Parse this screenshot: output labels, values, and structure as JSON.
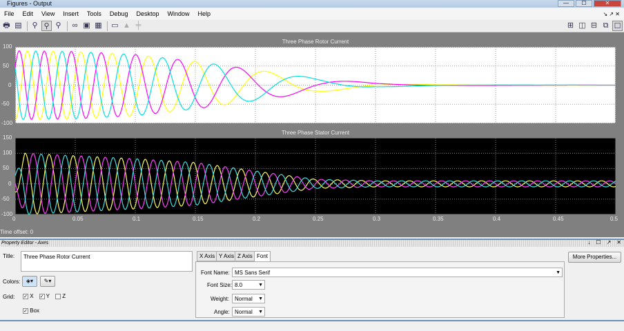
{
  "window": {
    "title": "Figures - Output",
    "buttons": [
      "—",
      "☐",
      "✕"
    ]
  },
  "menu": [
    "File",
    "Edit",
    "View",
    "Insert",
    "Tools",
    "Debug",
    "Desktop",
    "Window",
    "Help"
  ],
  "toolbar": {
    "icons": [
      "print-icon",
      "paste-icon",
      "zoom-in-icon",
      "zoom-out-active-icon",
      "zoom-icon",
      "binoculars-icon",
      "data-cursor-icon",
      "brush-icon",
      "dock-icon",
      "lock-icon",
      "link-icon"
    ],
    "layout_icons": [
      "tile-grid-icon",
      "split-vertical-icon",
      "split-horizontal-icon",
      "float-icon",
      "maximize-icon"
    ]
  },
  "chart_data": [
    {
      "type": "line",
      "title": "Three Phase Rotor Current",
      "background": "#ffffff",
      "grid": true,
      "xlim": [
        0,
        0.5
      ],
      "ylim": [
        -100,
        100
      ],
      "xticks": [
        0,
        0.05,
        0.1,
        0.15,
        0.2,
        0.25,
        0.3,
        0.35,
        0.4,
        0.45,
        0.5
      ],
      "yticks": [
        100,
        50,
        0,
        -50,
        -100
      ],
      "model": "i(t) = A(t)·sin(2π∫f dt + phase)",
      "envelope": {
        "t": [
          0,
          0.05,
          0.1,
          0.15,
          0.2,
          0.25,
          0.3,
          0.35,
          0.5
        ],
        "amplitude": [
          90,
          88,
          80,
          62,
          40,
          18,
          5,
          1,
          0
        ]
      },
      "frequency": {
        "t": [
          0,
          0.05,
          0.1,
          0.15,
          0.2,
          0.25,
          0.3,
          0.5
        ],
        "hz": [
          50,
          42,
          32,
          22,
          13,
          8,
          5,
          4
        ]
      },
      "series": [
        {
          "color": "#ffff00",
          "phase_deg": -90
        },
        {
          "color": "#ff00ff",
          "phase_deg": 30
        },
        {
          "color": "#00e0e0",
          "phase_deg": 150
        }
      ]
    },
    {
      "type": "line",
      "title": "Three Phase Stator Current",
      "background": "#000000",
      "grid": true,
      "xlim": [
        0,
        0.5
      ],
      "ylim": [
        -100,
        150
      ],
      "xticks": [
        0,
        0.05,
        0.1,
        0.15,
        0.2,
        0.25,
        0.3,
        0.35,
        0.4,
        0.45,
        0.5
      ],
      "yticks": [
        150,
        100,
        50,
        0,
        -50,
        -100
      ],
      "model": "i(t) = A(t)·sin(2π·50·t + phase)",
      "envelope": {
        "t": [
          0,
          0.008,
          0.05,
          0.1,
          0.15,
          0.2,
          0.25,
          0.3,
          0.5
        ],
        "amplitude": [
          30,
          100,
          92,
          82,
          70,
          42,
          15,
          10,
          10
        ]
      },
      "frequency_hz": 50,
      "series": [
        {
          "color": "#ffff60",
          "phase_deg": -60
        },
        {
          "color": "#ff40ff",
          "phase_deg": 180
        },
        {
          "color": "#40e0e0",
          "phase_deg": 60
        }
      ]
    }
  ],
  "time_offset": {
    "label": "Time offset:",
    "value": "0"
  },
  "property_editor": {
    "header": "Property Editor - Axes",
    "header_buttons": [
      "↓",
      "☐",
      "↗",
      "✕"
    ],
    "title_label": "Title:",
    "title_value": "Three Phase Rotor Current",
    "colors_label": "Colors:",
    "grid_label": "Grid:",
    "grid": {
      "x": {
        "label": "X",
        "checked": true
      },
      "y": {
        "label": "Y",
        "checked": true
      },
      "z": {
        "label": "Z",
        "checked": false
      }
    },
    "box": {
      "label": "Box",
      "checked": true
    },
    "tabs": [
      "X Axis",
      "Y Axis",
      "Z Axis",
      "Font"
    ],
    "active_tab": "Font",
    "font_name_label": "Font Name:",
    "font_name": "MS Sans Serif",
    "font_size_label": "Font Size:",
    "font_size": "8.0",
    "weight_label": "Weight:",
    "weight": "Normal",
    "angle_label": "Angle:",
    "angle": "Normal",
    "more_properties": "More Properties..."
  }
}
